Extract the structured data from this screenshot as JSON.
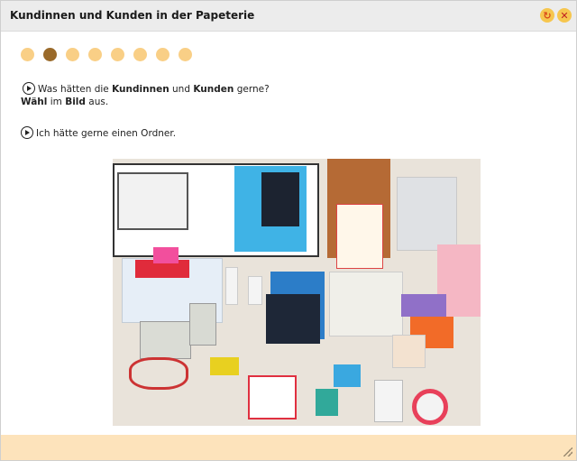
{
  "window": {
    "title": "Kundinnen und Kunden in der Papeterie"
  },
  "titlebar_buttons": {
    "reload_icon": "reload-icon",
    "close_icon": "close-icon",
    "reload_glyph": "↻",
    "close_glyph": "✕"
  },
  "progress": {
    "total": 8,
    "current": 2
  },
  "instruction": {
    "line1_pre": "Was hätten die ",
    "line1_b1": "Kundinnen",
    "line1_mid": " und ",
    "line1_b2": "Kunden",
    "line1_post": " gerne?",
    "line2_b1": "Wähl",
    "line2_mid": " im ",
    "line2_b2": "Bild",
    "line2_post": " aus."
  },
  "example": {
    "text": "Ich hätte gerne einen Ordner."
  },
  "colors": {
    "dot_inactive": "#f9cf86",
    "dot_active": "#9a6a2a",
    "footer": "#fde3bb",
    "titlebar": "#ececec"
  }
}
